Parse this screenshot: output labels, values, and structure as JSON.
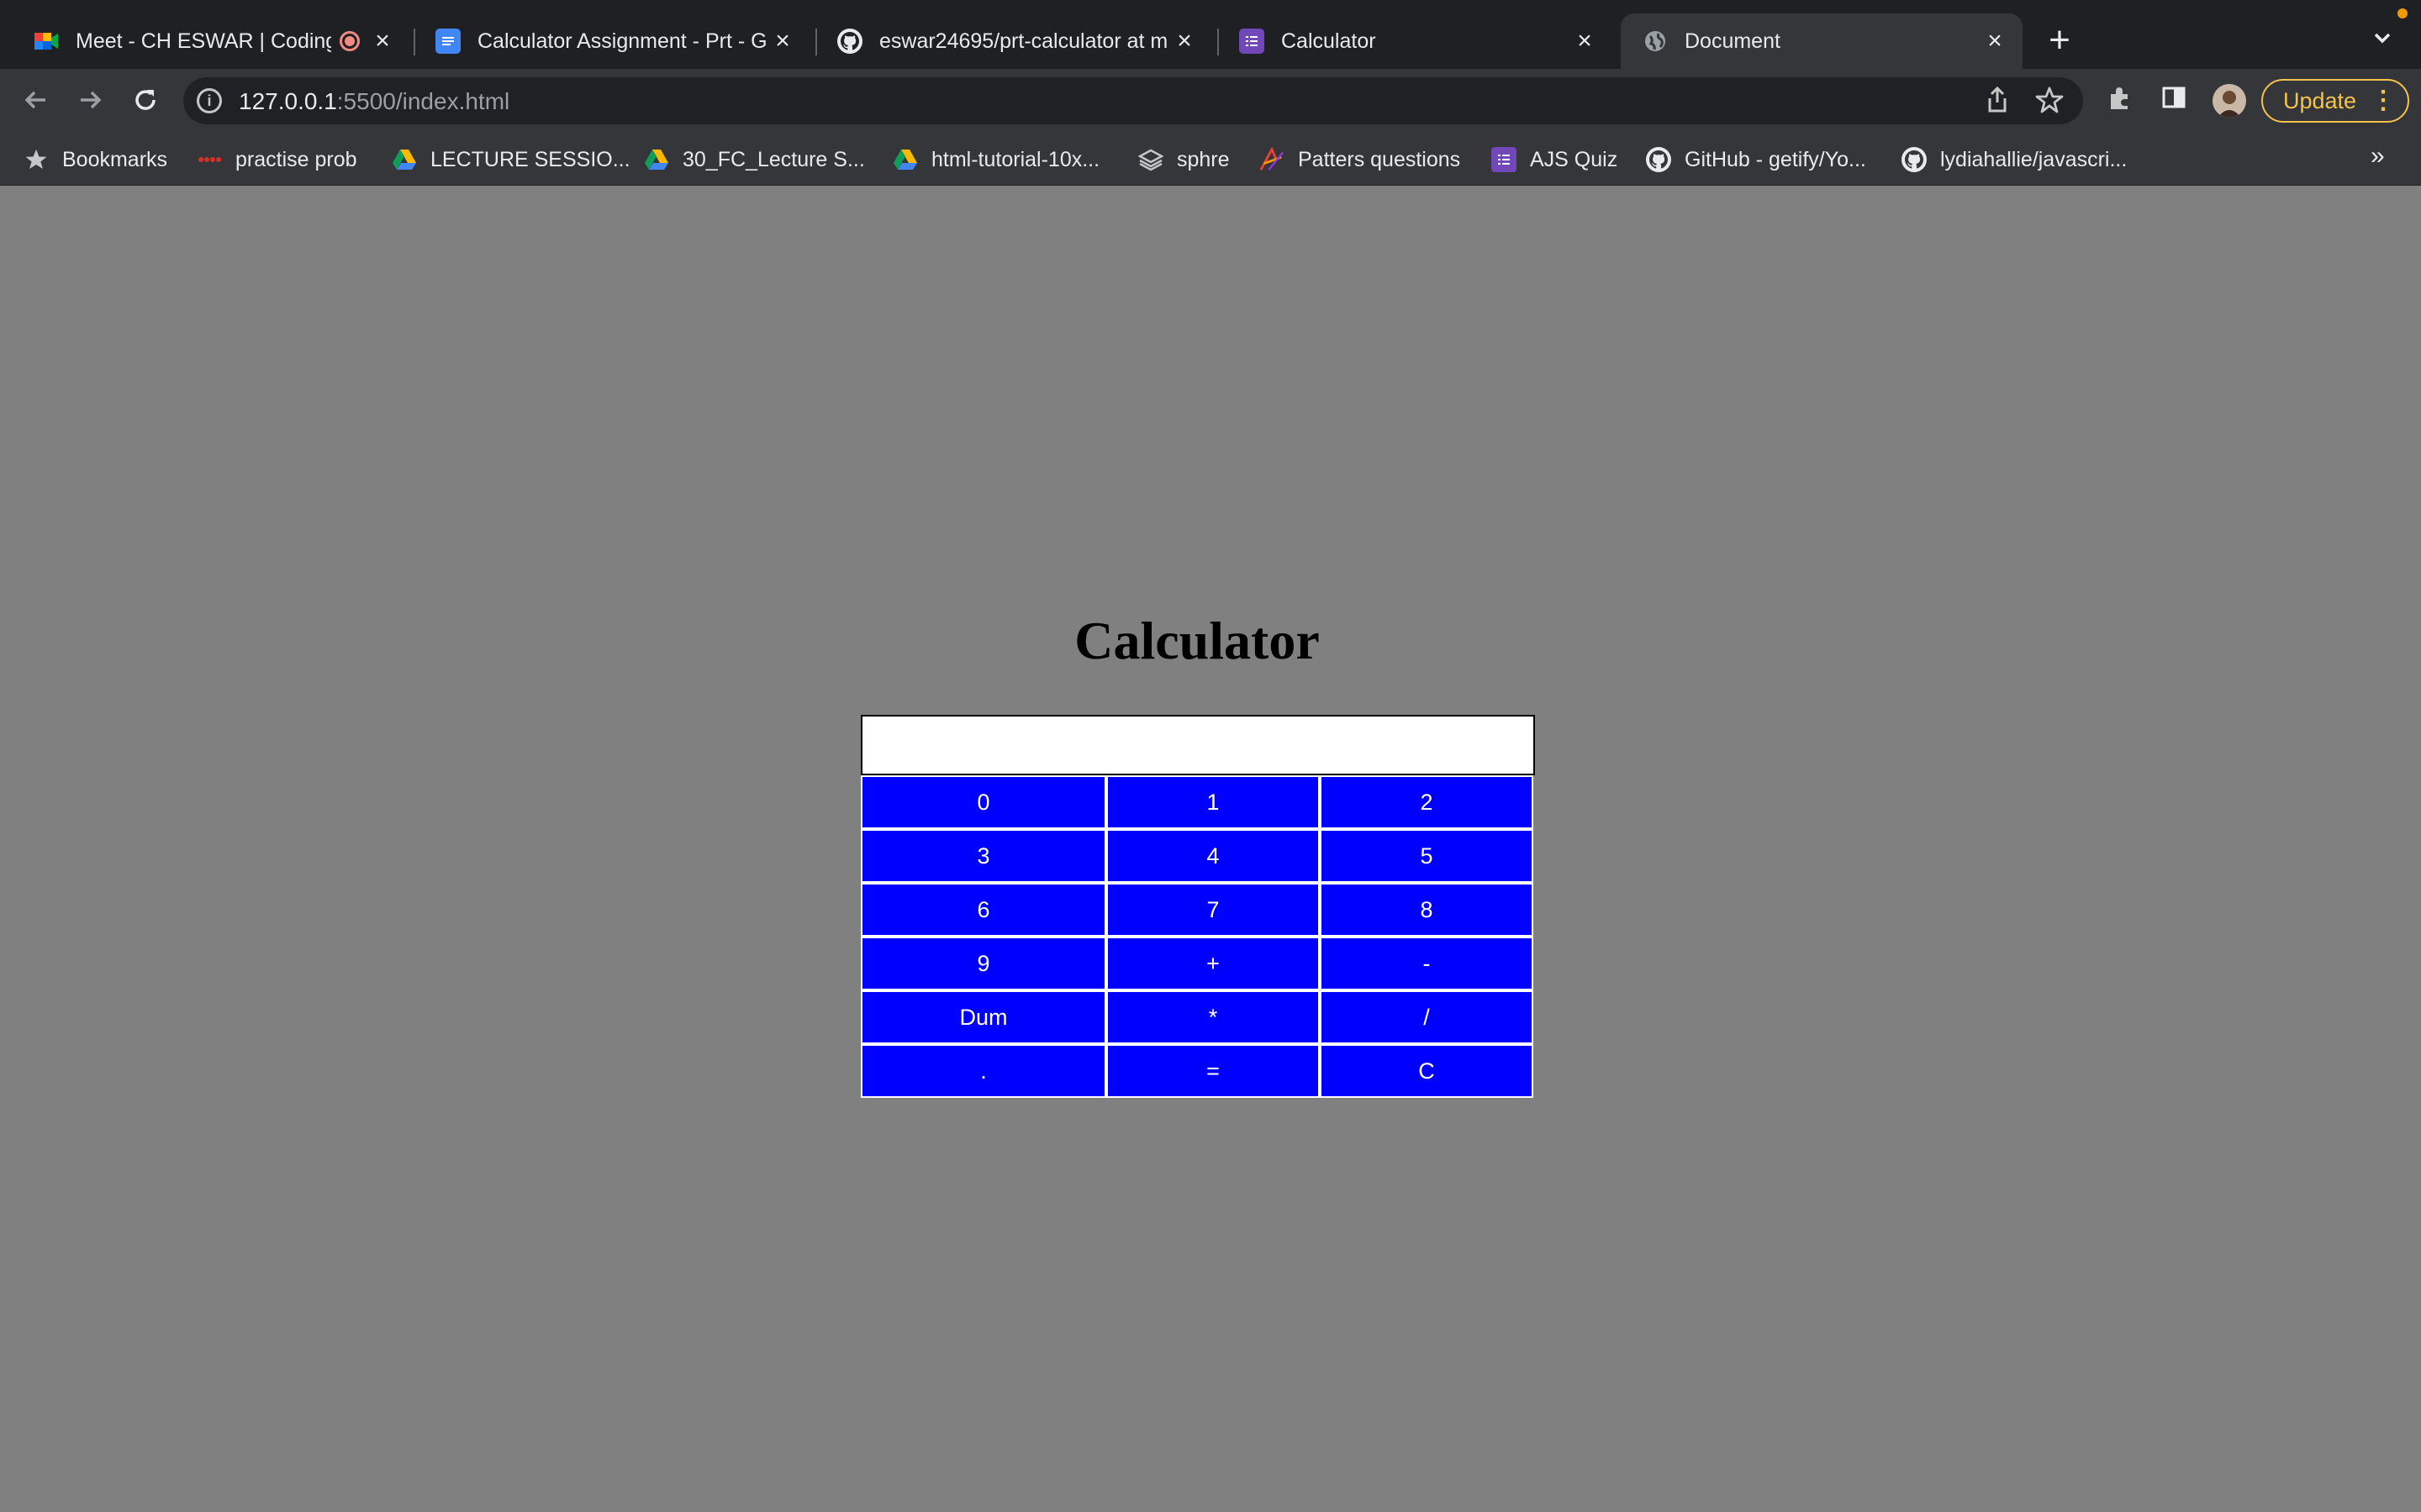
{
  "tabs": [
    {
      "title": "Meet - CH ESWAR | Coding",
      "icon": "google-meet-icon",
      "recording": true
    },
    {
      "title": "Calculator Assignment - Prt - G",
      "icon": "google-docs-icon"
    },
    {
      "title": "eswar24695/prt-calculator at m",
      "icon": "github-icon"
    },
    {
      "title": "Calculator",
      "icon": "forms-list-icon"
    },
    {
      "title": "Document",
      "icon": "globe-icon",
      "active": true
    }
  ],
  "toolbar": {
    "url_host": "127.0.0.1",
    "url_path": ":5500/index.html",
    "update_label": "Update"
  },
  "bookmarks": [
    {
      "label": "Bookmarks",
      "icon": "star-icon"
    },
    {
      "label": "practise prob",
      "icon": "practise-icon"
    },
    {
      "label": "LECTURE SESSIO...",
      "icon": "google-drive-icon"
    },
    {
      "label": "30_FC_Lecture S...",
      "icon": "google-drive-icon"
    },
    {
      "label": "html-tutorial-10x...",
      "icon": "google-drive-icon"
    },
    {
      "label": "sphre",
      "icon": "layers-icon"
    },
    {
      "label": "Patters questions",
      "icon": "pattern-icon"
    },
    {
      "label": "AJS Quiz",
      "icon": "forms-list-icon"
    },
    {
      "label": "GitHub - getify/Yo...",
      "icon": "github-icon"
    },
    {
      "label": "lydiahallie/javascri...",
      "icon": "github-icon"
    }
  ],
  "page": {
    "heading": "Calculator",
    "display_value": "",
    "keys": [
      [
        "0",
        "1",
        "2"
      ],
      [
        "3",
        "4",
        "5"
      ],
      [
        "6",
        "7",
        "8"
      ],
      [
        "9",
        "+",
        "-"
      ],
      [
        "Dum",
        "*",
        "/"
      ],
      [
        ".",
        "=",
        "C"
      ]
    ]
  },
  "colors": {
    "page_background": "#808080",
    "key_background": "#0000ff",
    "key_text": "#ffffff",
    "update_accent": "#f5c24b"
  }
}
